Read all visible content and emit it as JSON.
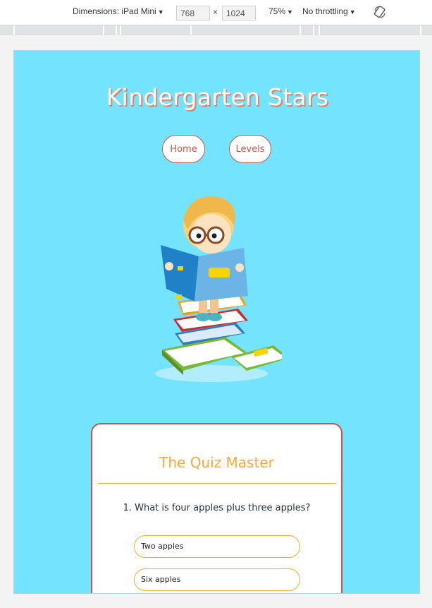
{
  "devtools": {
    "dimensions_label": "Dimensions: iPad Mini",
    "width_value": "768",
    "times_sign": "×",
    "height_value": "1024",
    "zoom": "75%",
    "throttling": "No throttling",
    "icons": [
      "caret-down-icon",
      "rotate-icon"
    ]
  },
  "site": {
    "title": "Kindergarten Stars",
    "nav": [
      {
        "label": "Home"
      },
      {
        "label": "Levels"
      }
    ]
  },
  "quiz": {
    "title": "The Quiz Master",
    "question": "1. What is four apples plus three apples?",
    "answers": [
      {
        "label": "Two apples"
      },
      {
        "label": "Six apples"
      }
    ]
  },
  "colors": {
    "background": "#74e4fe",
    "accent_red": "#c2574a",
    "accent_orange": "#f5a93a"
  }
}
